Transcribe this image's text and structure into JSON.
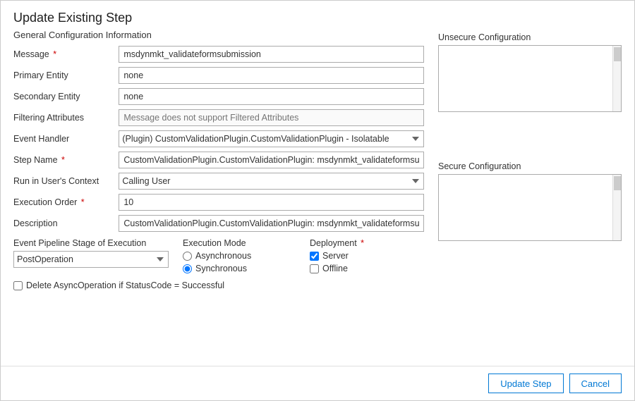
{
  "dialog": {
    "title": "Update Existing Step",
    "sections": {
      "general": "General Configuration Information",
      "unsecure": "Unsecure  Configuration",
      "secure": "Secure  Configuration"
    }
  },
  "form": {
    "message_label": "Message",
    "message_value": "msdynmkt_validateformsubmission",
    "primary_entity_label": "Primary Entity",
    "primary_entity_value": "none",
    "secondary_entity_label": "Secondary Entity",
    "secondary_entity_value": "none",
    "filtering_label": "Filtering Attributes",
    "filtering_placeholder": "Message does not support Filtered Attributes",
    "event_handler_label": "Event Handler",
    "event_handler_value": "(Plugin) CustomValidationPlugin.CustomValidationPlugin - Isolatable",
    "step_name_label": "Step Name",
    "step_name_value": "CustomValidationPlugin.CustomValidationPlugin: msdynmkt_validateformsubmission of any Ent",
    "run_in_context_label": "Run in User's Context",
    "run_in_context_value": "Calling User",
    "execution_order_label": "Execution Order",
    "execution_order_value": "10",
    "description_label": "Description",
    "description_value": "CustomValidationPlugin.CustomValidationPlugin: msdynmkt_validateformsubmission of any Ent"
  },
  "pipeline": {
    "label": "Event Pipeline Stage of Execution",
    "value": "PostOperation"
  },
  "execution_mode": {
    "label": "Execution Mode",
    "async_label": "Asynchronous",
    "sync_label": "Synchronous"
  },
  "deployment": {
    "label": "Deployment",
    "server_label": "Server",
    "offline_label": "Offline"
  },
  "delete_check": {
    "label": "Delete AsyncOperation if StatusCode = Successful"
  },
  "footer": {
    "update_button": "Update Step",
    "cancel_button": "Cancel"
  }
}
